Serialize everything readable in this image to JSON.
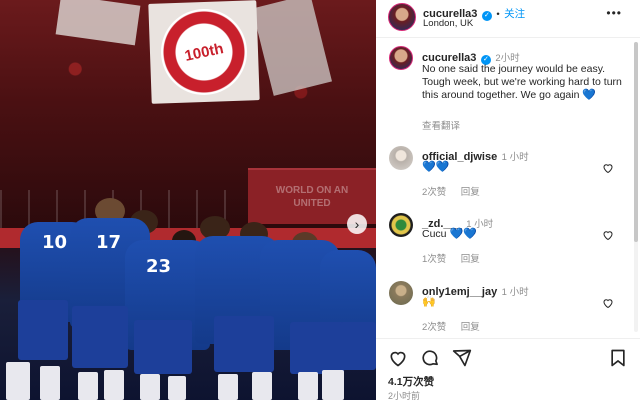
{
  "post": {
    "username": "cucurella3",
    "follow_label": "关注",
    "location": "London, UK",
    "more_label": "•••",
    "caption": {
      "time": "2小时",
      "text": "No one said the journey would be easy. Tough week, but we're working hard to turn this around together. We go again",
      "emoji": "💙",
      "translate_label": "查看翻译"
    },
    "photo": {
      "banner_text": "100th",
      "board_text": "WORLD ON AN\nUNITED"
    }
  },
  "comments": [
    {
      "username": "official_djwise",
      "time": "1 小时",
      "text": "",
      "emoji": "💙💙",
      "likes": "2次赞",
      "reply": "回复"
    },
    {
      "username": "_zd.___",
      "time": "1 小时",
      "text": "Cucu",
      "emoji": "💙💙",
      "likes": "1次赞",
      "reply": "回复"
    },
    {
      "username": "only1emj__jay",
      "time": "1 小时",
      "text": "",
      "emoji": "🙌",
      "likes": "2次赞",
      "reply": "回复"
    }
  ],
  "actions": {
    "likes_count": "4.1万次赞",
    "posted_time": "2小时前"
  },
  "colors": {
    "accent": "#0095f6",
    "verified": "#0095f6",
    "kit_blue": "#1f4fb0"
  }
}
